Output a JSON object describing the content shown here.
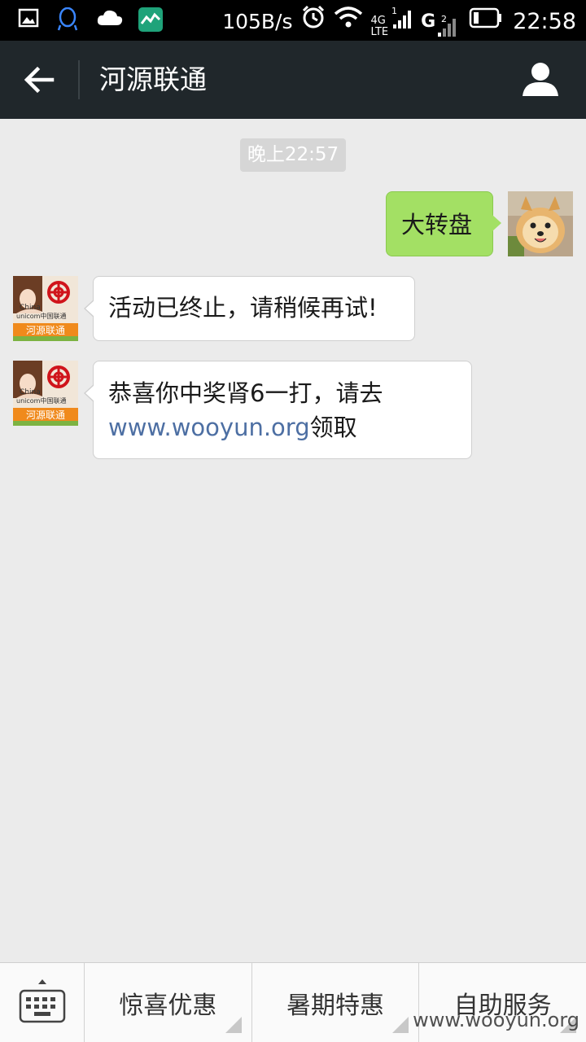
{
  "status_bar": {
    "net_speed": "105B/s",
    "network_4g": "4G",
    "network_lte": "LTE",
    "sim1_badge": "1",
    "sim2_label": "G",
    "sim2_badge": "2",
    "time": "22:58",
    "icons": [
      "gallery-icon",
      "qq-icon",
      "cloud-icon",
      "stock-icon",
      "alarm-icon",
      "wifi-icon",
      "signal-icon",
      "battery-icon"
    ]
  },
  "nav": {
    "title": "河源联通",
    "back_icon": "back-arrow-icon",
    "contact_icon": "person-icon"
  },
  "chat": {
    "timestamp": "晚上22:57",
    "messages": [
      {
        "direction": "out",
        "text": "大转盘",
        "avatar": "dog-avatar"
      },
      {
        "direction": "in",
        "text": "活动已终止，请稍候再试!",
        "avatar": "unicom-avatar"
      },
      {
        "direction": "in",
        "text_before": "恭喜你中奖肾6一打，请去",
        "link": "www.wooyun.org",
        "text_after": "领取",
        "avatar": "unicom-avatar"
      }
    ],
    "avatar_text": {
      "china": "China",
      "unicom": "unicom中国联通",
      "banner": "河源联通"
    }
  },
  "bottom_menu": {
    "keyboard_icon": "keyboard-icon",
    "items": [
      {
        "label": "惊喜优惠"
      },
      {
        "label": "暑期特惠"
      },
      {
        "label": "自助服务"
      }
    ],
    "watermark": "www.wooyun.org"
  },
  "colors": {
    "nav_bg": "#20272b",
    "chat_bg": "#ebebeb",
    "outgoing_bubble": "#a3e064",
    "incoming_bubble": "#ffffff",
    "link": "#4d6fa3"
  }
}
